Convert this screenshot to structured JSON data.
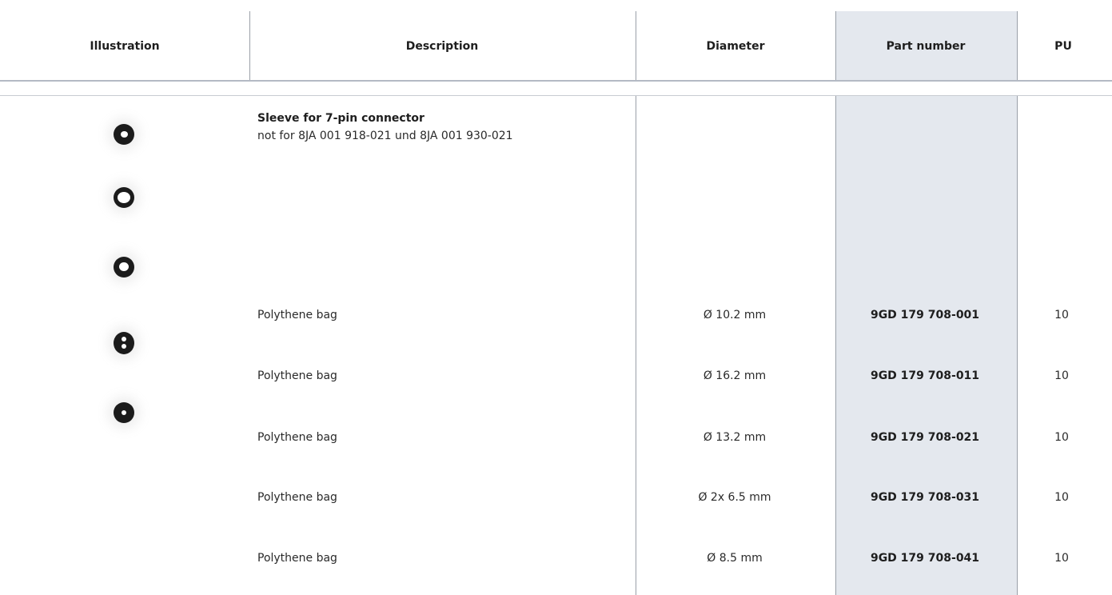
{
  "table": {
    "headers": {
      "illustration": "Illustration",
      "description": "Description",
      "diameter": "Diameter",
      "part_number": "Part number",
      "pu": "PU"
    },
    "product": {
      "title": "Sleeve for 7-pin connector",
      "note": "not for 8JA 001 918-021 und 8JA 001 930-021"
    },
    "rows": [
      {
        "description": "Polythene bag",
        "diameter": "Ø 10.2 mm",
        "part_number": "9GD 179 708-001",
        "pu": "10"
      },
      {
        "description": "Polythene bag",
        "diameter": "Ø 16.2 mm",
        "part_number": "9GD 179 708-011",
        "pu": "10"
      },
      {
        "description": "Polythene bag",
        "diameter": "Ø 13.2 mm",
        "part_number": "9GD 179 708-021",
        "pu": "10"
      },
      {
        "description": "Polythene bag",
        "diameter": "Ø 2x 6.5 mm",
        "part_number": "9GD 179 708-031",
        "pu": "10"
      },
      {
        "description": "Polythene bag",
        "diameter": "Ø 8.5 mm",
        "part_number": "9GD 179 708-041",
        "pu": "10"
      }
    ]
  },
  "illustrations": [
    "sleeve-10-2-icon",
    "sleeve-16-2-icon",
    "sleeve-13-2-icon",
    "sleeve-2x6-5-icon",
    "sleeve-8-5-icon"
  ],
  "colors": {
    "highlight_column": "#e4e8ee",
    "rule": "#b4bac4",
    "text": "#222222"
  }
}
